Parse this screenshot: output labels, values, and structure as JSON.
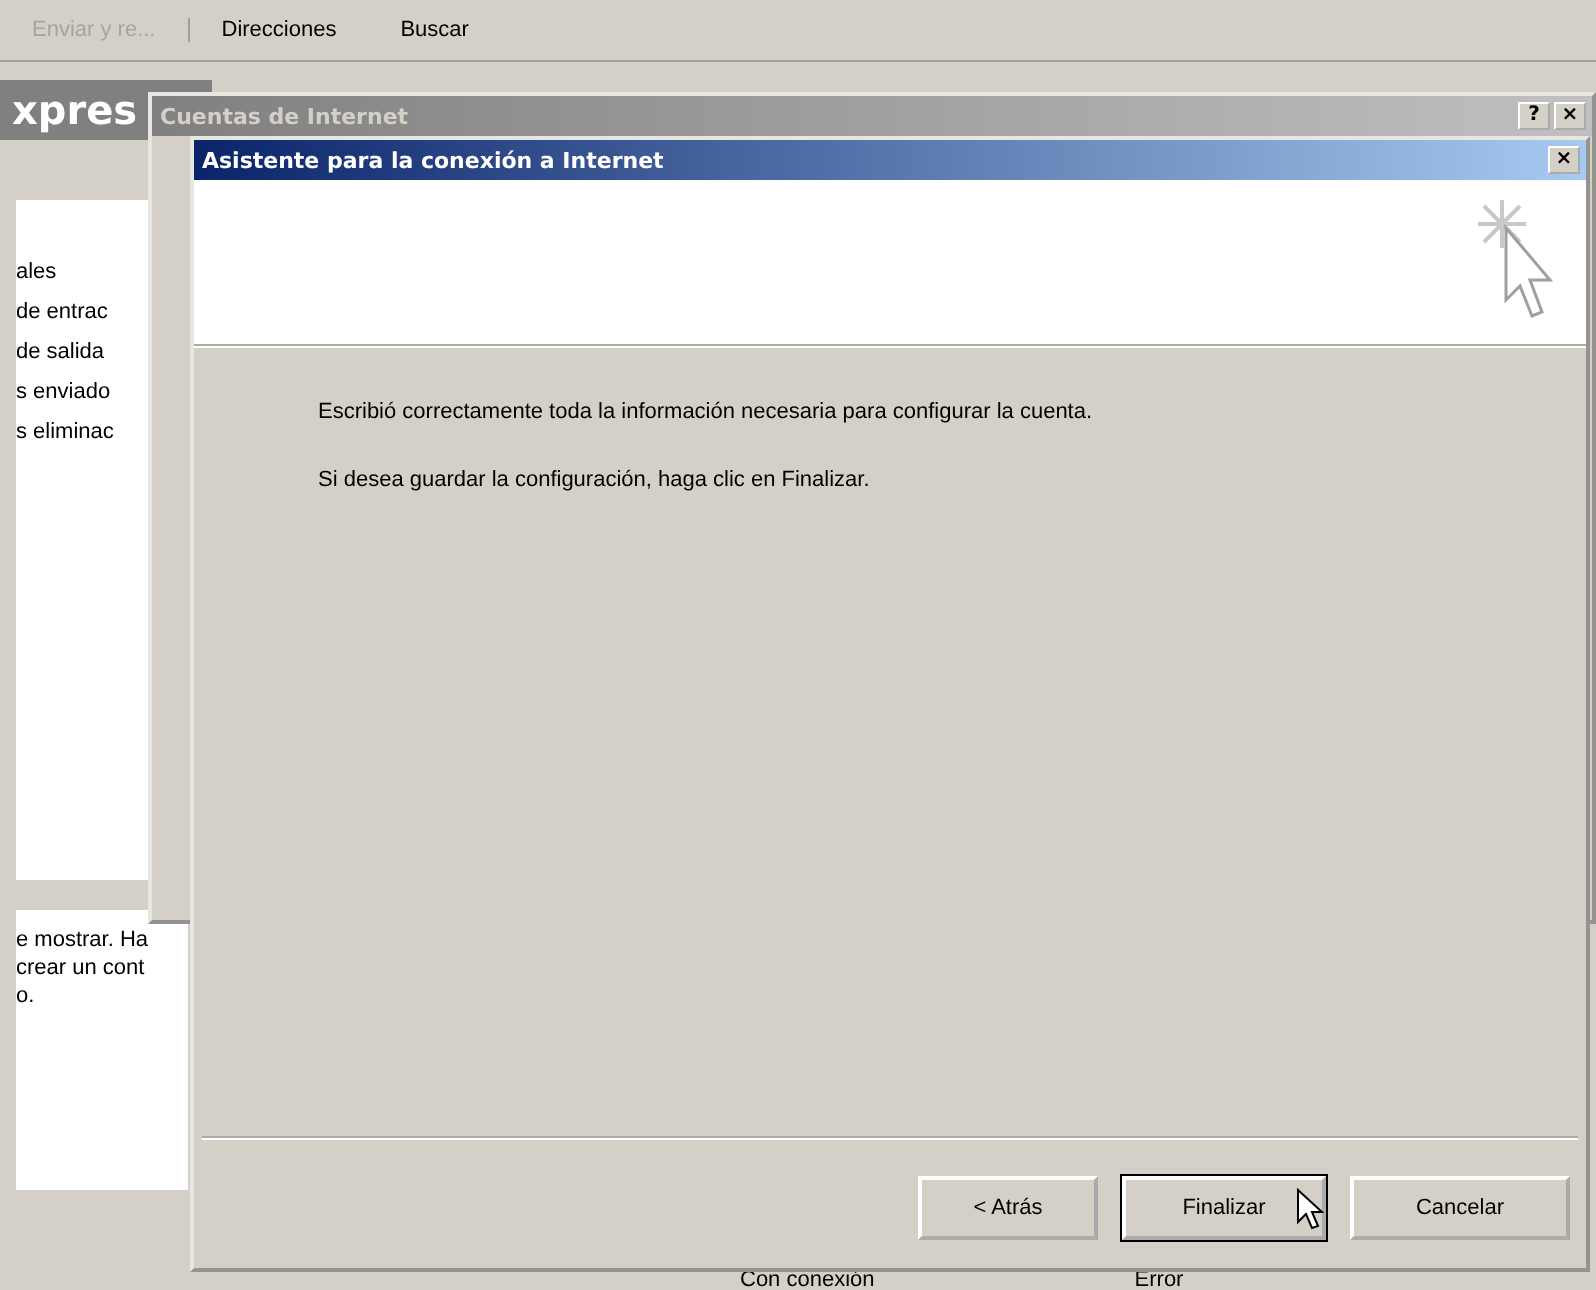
{
  "app": {
    "toolbar": [
      {
        "label": "Enviar y re...",
        "disabled": true
      },
      {
        "label": "Direcciones",
        "disabled": false
      },
      {
        "label": "Buscar",
        "disabled": false
      }
    ],
    "title": "xpres",
    "folders": [
      "ales",
      "de entrac",
      "de salida",
      "s enviado",
      "s eliminac"
    ],
    "message_lines": [
      "e mostrar. Ha",
      "crear un cont",
      "o."
    ],
    "status_bar": [
      "Con conexión",
      "Error"
    ]
  },
  "accounts_window": {
    "title": "Cuentas de Internet",
    "active": false,
    "buttons": [
      "?",
      "×"
    ]
  },
  "wizard": {
    "title": "Asistente para la conexión a Internet",
    "active": true,
    "close": "×",
    "paragraphs": [
      "Escribió correctamente toda la información necesaria para configurar la cuenta.",
      "Si desea guardar la configuración, haga clic en Finalizar."
    ],
    "buttons": [
      {
        "label": "< Atrás",
        "default": false
      },
      {
        "label": "Finalizar",
        "default": true
      },
      {
        "label": "Cancelar",
        "default": false
      }
    ]
  }
}
